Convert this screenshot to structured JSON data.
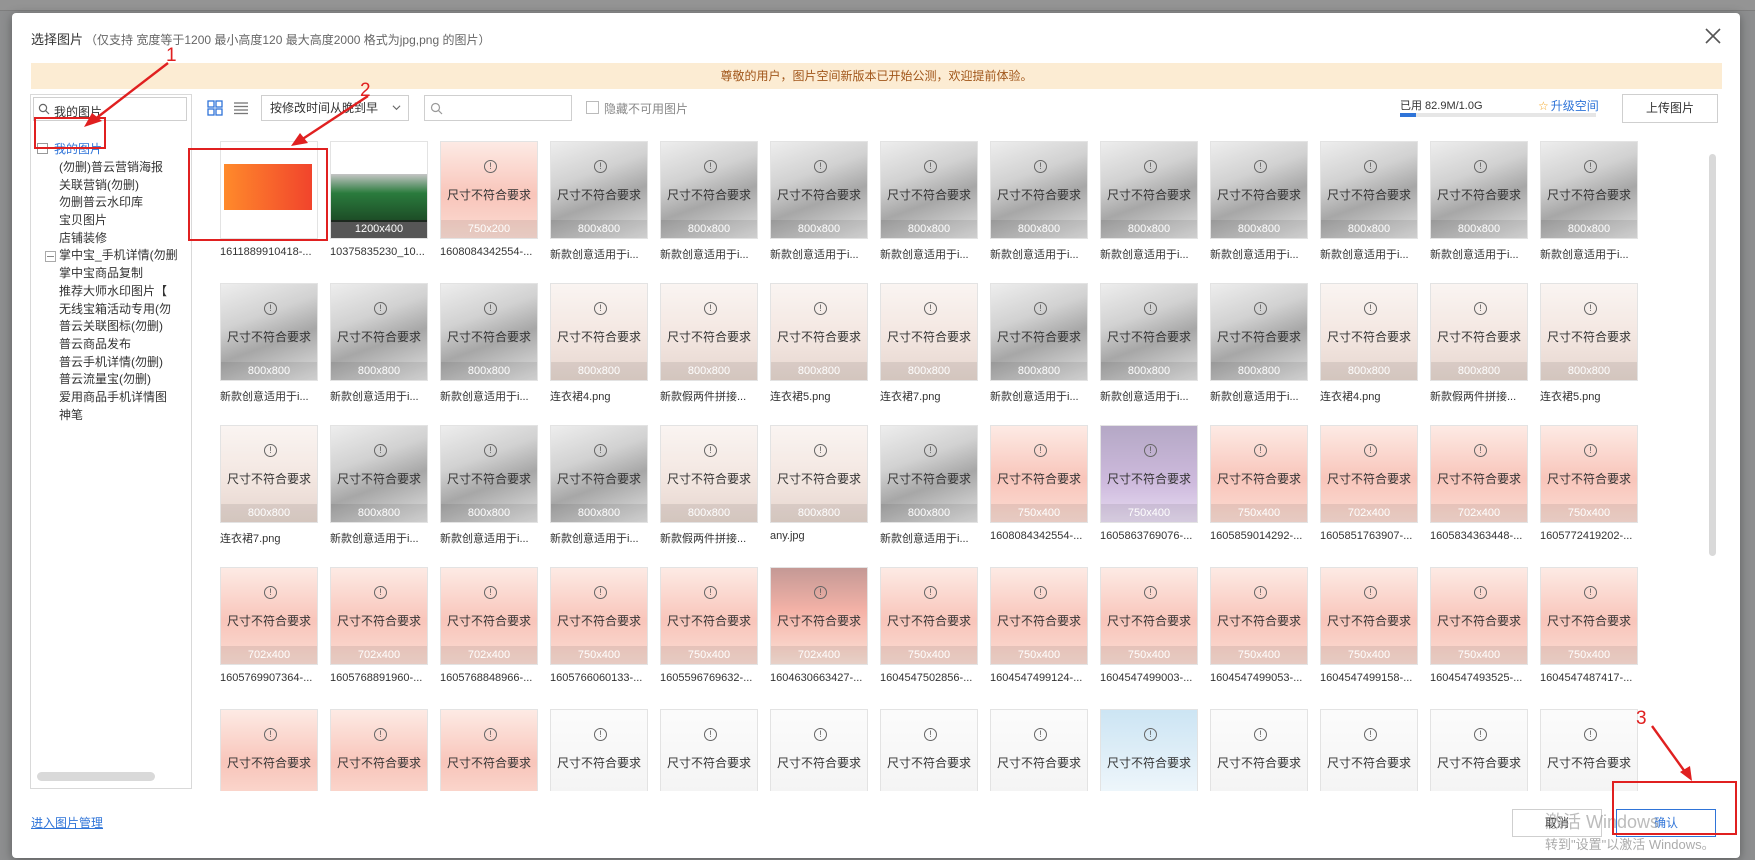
{
  "dialog": {
    "title": "选择图片",
    "hint": "（仅支持 宽度等于1200 最小高度120 最大高度2000 格式为jpg,png 的图片）",
    "notice": "尊敬的用户，图片空间新版本已开始公测，欢迎提前体验。"
  },
  "tree": {
    "search_value": "我的图片",
    "root_label": "我的图片",
    "items": [
      {
        "label": "(勿删)普云营销海报",
        "sub": false,
        "fold": false
      },
      {
        "label": "关联营销(勿删)",
        "sub": false,
        "fold": false
      },
      {
        "label": "勿删普云水印库",
        "sub": false,
        "fold": false
      },
      {
        "label": "宝贝图片",
        "sub": false,
        "fold": false
      },
      {
        "label": "店铺装修",
        "sub": false,
        "fold": false
      },
      {
        "label": "掌中宝_手机详情(勿删",
        "sub": false,
        "fold": true
      },
      {
        "label": "掌中宝商品复制",
        "sub": false,
        "fold": false
      },
      {
        "label": "推荐大师水印图片【",
        "sub": false,
        "fold": false
      },
      {
        "label": "无线宝箱活动专用(勿",
        "sub": false,
        "fold": false
      },
      {
        "label": "普云关联图标(勿删)",
        "sub": false,
        "fold": false
      },
      {
        "label": "普云商品发布",
        "sub": false,
        "fold": false
      },
      {
        "label": "普云手机详情(勿删)",
        "sub": false,
        "fold": false
      },
      {
        "label": "普云流量宝(勿删)",
        "sub": false,
        "fold": false
      },
      {
        "label": "爱用商品手机详情图",
        "sub": false,
        "fold": false
      },
      {
        "label": "神笔",
        "sub": false,
        "fold": false
      }
    ]
  },
  "toolbar": {
    "sort_label": "按修改时间从晚到早",
    "search_placeholder": "",
    "hide_unusable_label": "隐藏不可用图片",
    "quota_label": "已用 82.9M/1.0G",
    "quota_fraction": 0.081,
    "upgrade_label": "升级空间",
    "upload_label": "上传图片"
  },
  "grid": {
    "unfit_message": "尺寸不符合要求",
    "warn_symbol": "!",
    "images": [
      {
        "name": "1611889910418-...",
        "dim": "",
        "ok": true,
        "kind": "banner"
      },
      {
        "name": "10375835230_10...",
        "dim": "1200x400",
        "ok": true,
        "kind": "green"
      },
      {
        "name": "1608084342554-...",
        "dim": "750x200",
        "ok": false,
        "kind": "red"
      },
      {
        "name": "新款创意适用于i...",
        "dim": "800x800",
        "ok": false,
        "kind": "phone"
      },
      {
        "name": "新款创意适用于i...",
        "dim": "800x800",
        "ok": false,
        "kind": "phone"
      },
      {
        "name": "新款创意适用于i...",
        "dim": "800x800",
        "ok": false,
        "kind": "phone"
      },
      {
        "name": "新款创意适用于i...",
        "dim": "800x800",
        "ok": false,
        "kind": "phone"
      },
      {
        "name": "新款创意适用于i...",
        "dim": "800x800",
        "ok": false,
        "kind": "phone"
      },
      {
        "name": "新款创意适用于i...",
        "dim": "800x800",
        "ok": false,
        "kind": "phone"
      },
      {
        "name": "新款创意适用于i...",
        "dim": "800x800",
        "ok": false,
        "kind": "phone"
      },
      {
        "name": "新款创意适用于i...",
        "dim": "800x800",
        "ok": false,
        "kind": "phone"
      },
      {
        "name": "新款创意适用于i...",
        "dim": "800x800",
        "ok": false,
        "kind": "phone"
      },
      {
        "name": "新款创意适用于i...",
        "dim": "800x800",
        "ok": false,
        "kind": "phone"
      },
      {
        "name": "新款创意适用于i...",
        "dim": "800x800",
        "ok": false,
        "kind": "phone"
      },
      {
        "name": "新款创意适用于i...",
        "dim": "800x800",
        "ok": false,
        "kind": "phone"
      },
      {
        "name": "新款创意适用于i...",
        "dim": "800x800",
        "ok": false,
        "kind": "phone"
      },
      {
        "name": "连衣裙4.png",
        "dim": "800x800",
        "ok": false,
        "kind": "dress"
      },
      {
        "name": "新款假两件拼接...",
        "dim": "800x800",
        "ok": false,
        "kind": "dress"
      },
      {
        "name": "连衣裙5.png",
        "dim": "800x800",
        "ok": false,
        "kind": "dress"
      },
      {
        "name": "连衣裙7.png",
        "dim": "800x800",
        "ok": false,
        "kind": "dress"
      },
      {
        "name": "新款创意适用于i...",
        "dim": "800x800",
        "ok": false,
        "kind": "phone"
      },
      {
        "name": "新款创意适用于i...",
        "dim": "800x800",
        "ok": false,
        "kind": "phone"
      },
      {
        "name": "新款创意适用于i...",
        "dim": "800x800",
        "ok": false,
        "kind": "phone"
      },
      {
        "name": "连衣裙4.png",
        "dim": "800x800",
        "ok": false,
        "kind": "dress"
      },
      {
        "name": "新款假两件拼接...",
        "dim": "800x800",
        "ok": false,
        "kind": "dress"
      },
      {
        "name": "连衣裙5.png",
        "dim": "800x800",
        "ok": false,
        "kind": "dress"
      },
      {
        "name": "连衣裙7.png",
        "dim": "800x800",
        "ok": false,
        "kind": "dress"
      },
      {
        "name": "新款创意适用于i...",
        "dim": "800x800",
        "ok": false,
        "kind": "phone"
      },
      {
        "name": "新款创意适用于i...",
        "dim": "800x800",
        "ok": false,
        "kind": "phone"
      },
      {
        "name": "新款创意适用于i...",
        "dim": "800x800",
        "ok": false,
        "kind": "phone"
      },
      {
        "name": "新款假两件拼接...",
        "dim": "800x800",
        "ok": false,
        "kind": "dress"
      },
      {
        "name": "any.jpg",
        "dim": "800x800",
        "ok": false,
        "kind": "dress"
      },
      {
        "name": "新款创意适用于i...",
        "dim": "800x800",
        "ok": false,
        "kind": "phone"
      },
      {
        "name": "1608084342554-...",
        "dim": "750x400",
        "ok": false,
        "kind": "red"
      },
      {
        "name": "1605863769076-...",
        "dim": "750x400",
        "ok": false,
        "kind": "purple"
      },
      {
        "name": "1605859014292-...",
        "dim": "750x400",
        "ok": false,
        "kind": "red"
      },
      {
        "name": "1605851763907-...",
        "dim": "702x400",
        "ok": false,
        "kind": "red"
      },
      {
        "name": "1605834363448-...",
        "dim": "702x400",
        "ok": false,
        "kind": "red"
      },
      {
        "name": "1605772419202-...",
        "dim": "750x400",
        "ok": false,
        "kind": "red"
      },
      {
        "name": "1605769907364-...",
        "dim": "702x400",
        "ok": false,
        "kind": "red"
      },
      {
        "name": "1605768891960-...",
        "dim": "702x400",
        "ok": false,
        "kind": "red"
      },
      {
        "name": "1605768848966-...",
        "dim": "702x400",
        "ok": false,
        "kind": "red"
      },
      {
        "name": "1605766060133-...",
        "dim": "750x400",
        "ok": false,
        "kind": "red"
      },
      {
        "name": "1605596769632-...",
        "dim": "750x400",
        "ok": false,
        "kind": "red"
      },
      {
        "name": "1604630663427-...",
        "dim": "702x400",
        "ok": false,
        "kind": "darkred"
      },
      {
        "name": "1604547502856-...",
        "dim": "750x400",
        "ok": false,
        "kind": "red"
      },
      {
        "name": "1604547499124-...",
        "dim": "750x400",
        "ok": false,
        "kind": "red"
      },
      {
        "name": "1604547499003-...",
        "dim": "750x400",
        "ok": false,
        "kind": "red"
      },
      {
        "name": "1604547499053-...",
        "dim": "750x400",
        "ok": false,
        "kind": "red"
      },
      {
        "name": "1604547499158-...",
        "dim": "750x400",
        "ok": false,
        "kind": "red"
      },
      {
        "name": "1604547493525-...",
        "dim": "750x400",
        "ok": false,
        "kind": "red"
      },
      {
        "name": "1604547487417-...",
        "dim": "750x400",
        "ok": false,
        "kind": "red"
      },
      {
        "name": "",
        "dim": "",
        "ok": false,
        "kind": "red"
      },
      {
        "name": "",
        "dim": "",
        "ok": false,
        "kind": "red"
      },
      {
        "name": "",
        "dim": "",
        "ok": false,
        "kind": "red"
      },
      {
        "name": "",
        "dim": "",
        "ok": false,
        "kind": "doc"
      },
      {
        "name": "",
        "dim": "",
        "ok": false,
        "kind": "doc"
      },
      {
        "name": "",
        "dim": "",
        "ok": false,
        "kind": "doc"
      },
      {
        "name": "",
        "dim": "",
        "ok": false,
        "kind": "doc"
      },
      {
        "name": "",
        "dim": "",
        "ok": false,
        "kind": "doc"
      },
      {
        "name": "",
        "dim": "",
        "ok": false,
        "kind": "blue"
      },
      {
        "name": "",
        "dim": "",
        "ok": false,
        "kind": "doc"
      },
      {
        "name": "",
        "dim": "",
        "ok": false,
        "kind": "doc"
      },
      {
        "name": "",
        "dim": "",
        "ok": false,
        "kind": "doc"
      },
      {
        "name": "",
        "dim": "",
        "ok": false,
        "kind": "doc"
      }
    ]
  },
  "footer": {
    "manage_link": "进入图片管理",
    "cancel_label": "取消",
    "confirm_label": "确认"
  },
  "watermark": {
    "line1": "激活 Windows",
    "line2": "转到\"设置\"以激活 Windows。"
  },
  "annotations": {
    "n1": "1",
    "n2": "2",
    "n3": "3"
  },
  "colors": {
    "accent": "#2f74d8",
    "annotation": "#e02020",
    "notice_bg": "#fcecd3"
  }
}
